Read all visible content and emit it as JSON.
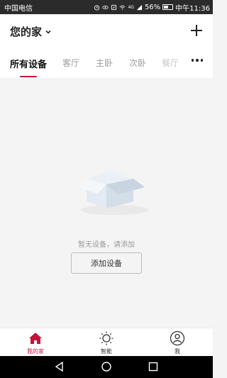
{
  "status_bar": {
    "carrier": "中国电信",
    "signal_4g": "4G",
    "battery_pct": "56%",
    "battery_level": 0.56,
    "time": "中午11:36"
  },
  "header": {
    "home_title": "您的家"
  },
  "tabs": [
    {
      "label": "所有设备",
      "active": true
    },
    {
      "label": "客厅",
      "active": false
    },
    {
      "label": "主卧",
      "active": false
    },
    {
      "label": "次卧",
      "active": false
    },
    {
      "label": "餐厅",
      "active": false
    }
  ],
  "empty_state": {
    "message": "暂无设备，请添加",
    "button_label": "添加设备"
  },
  "bottom_nav": [
    {
      "label": "我的家",
      "icon": "home-icon",
      "active": true
    },
    {
      "label": "智能",
      "icon": "sun-icon",
      "active": false
    },
    {
      "label": "我",
      "icon": "user-icon",
      "active": false
    }
  ],
  "colors": {
    "accent": "#c5143c",
    "background": "#f4f4f4"
  }
}
